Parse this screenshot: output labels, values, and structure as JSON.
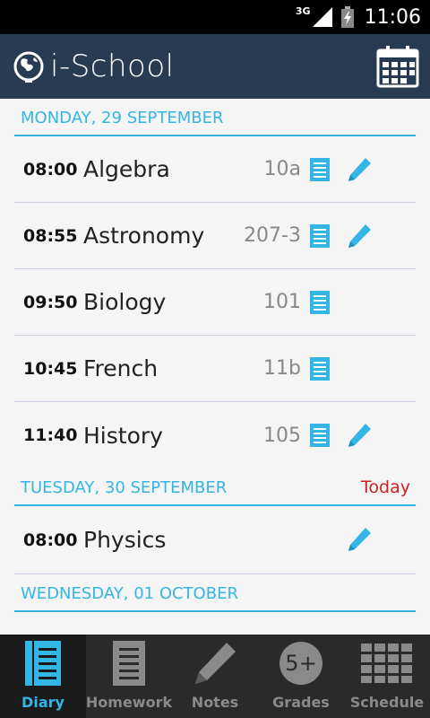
{
  "status_bar": {
    "network": "3G",
    "time": "11:06"
  },
  "app": {
    "title": "i-School"
  },
  "days": [
    {
      "date": "MONDAY, 29 SEPTEMBER",
      "today_label": "",
      "lessons": [
        {
          "time": "08:00",
          "subject": "Algebra",
          "room": "10a",
          "homework": true,
          "note": true
        },
        {
          "time": "08:55",
          "subject": "Astronomy",
          "room": "207-3",
          "homework": true,
          "note": true
        },
        {
          "time": "09:50",
          "subject": "Biology",
          "room": "101",
          "homework": true,
          "note": false
        },
        {
          "time": "10:45",
          "subject": "French",
          "room": "11b",
          "homework": true,
          "note": false
        },
        {
          "time": "11:40",
          "subject": "History",
          "room": "105",
          "homework": true,
          "note": true
        }
      ]
    },
    {
      "date": "TUESDAY, 30 SEPTEMBER",
      "today_label": "Today",
      "lessons": [
        {
          "time": "08:00",
          "subject": "Physics",
          "room": "",
          "homework": false,
          "note": true
        }
      ]
    },
    {
      "date": "WEDNESDAY, 01 OCTOBER",
      "today_label": "",
      "lessons": []
    }
  ],
  "nav": {
    "diary": "Diary",
    "homework": "Homework",
    "notes": "Notes",
    "grades": "Grades",
    "grades_badge": "5+",
    "schedule": "Schedule"
  },
  "colors": {
    "accent": "#33b5e5",
    "app_bar": "#273b52",
    "today": "#cc2222"
  },
  "icons": [
    "globe-icon",
    "calendar-icon",
    "homework-list-icon",
    "pencil-icon",
    "diary-icon",
    "homework-icon",
    "notes-icon",
    "grades-icon",
    "schedule-icon"
  ]
}
